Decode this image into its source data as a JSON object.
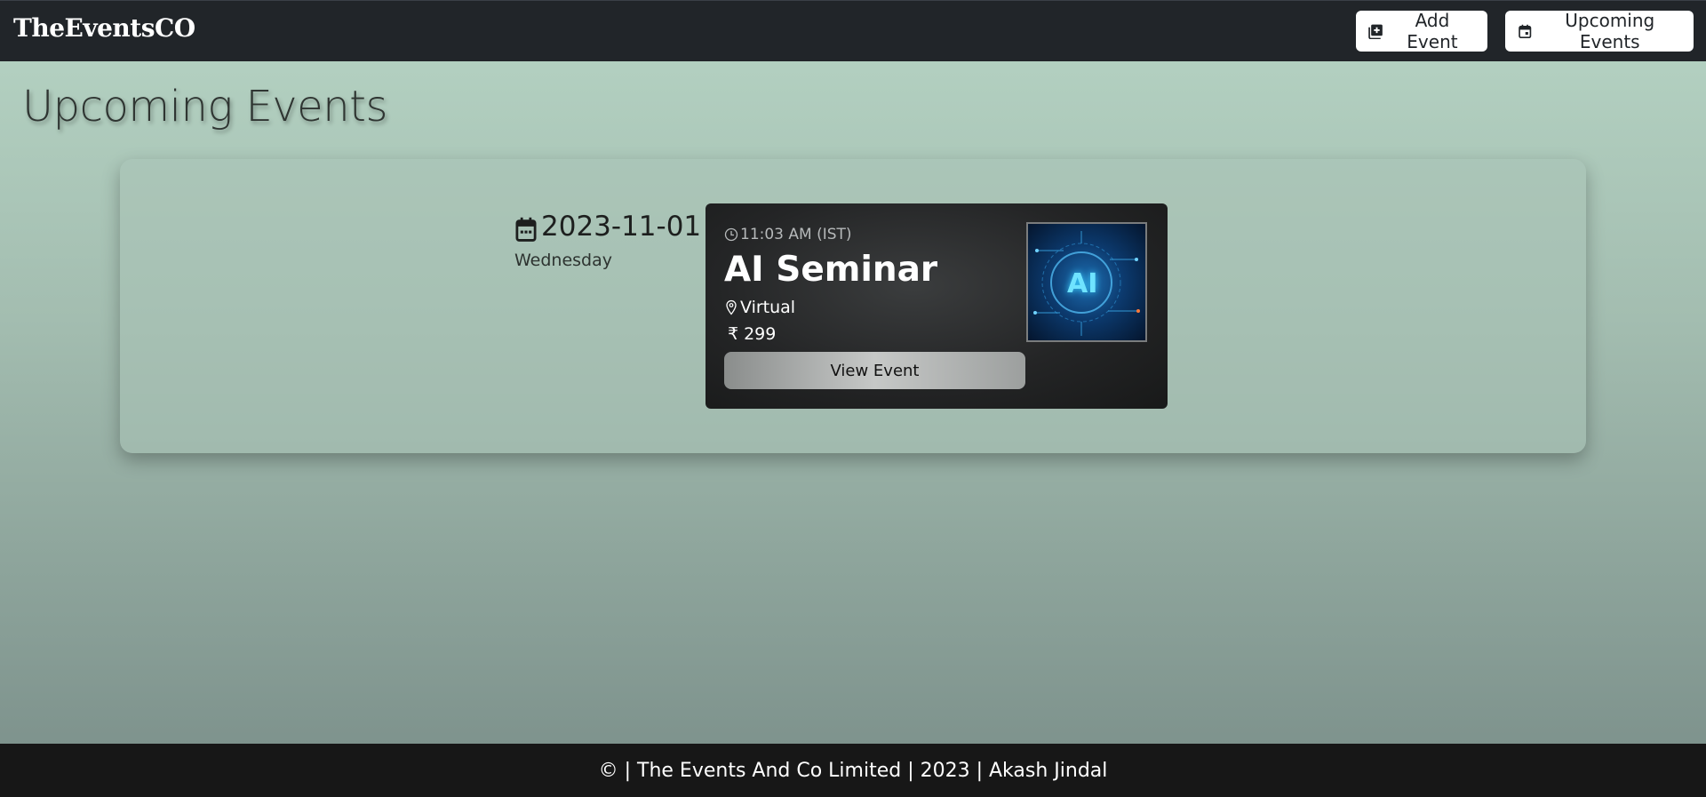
{
  "navbar": {
    "brand": "TheEventsCO",
    "add_event_label": "Add Event",
    "upcoming_events_label": "Upcoming Events"
  },
  "page": {
    "title": "Upcoming Events"
  },
  "event_date": {
    "date": "2023-11-01",
    "weekday": "Wednesday"
  },
  "event": {
    "time": "11:03 AM (IST)",
    "title": "AI Seminar",
    "location": "Virtual",
    "currency_symbol": "₹",
    "price": "299",
    "view_button_label": "View Event",
    "thumbnail_text": "AI"
  },
  "footer": {
    "text": "© | The Events And Co Limited | 2023 | Akash Jindal"
  },
  "colors": {
    "navbar_bg": "#212529",
    "footer_bg": "#171717",
    "card_bg": "#242526"
  },
  "icons": {
    "add_event": "calendar-plus-icon",
    "upcoming_events": "calendar-icon",
    "date": "calendar-icon",
    "time": "clock-icon",
    "location": "map-pin-icon"
  }
}
